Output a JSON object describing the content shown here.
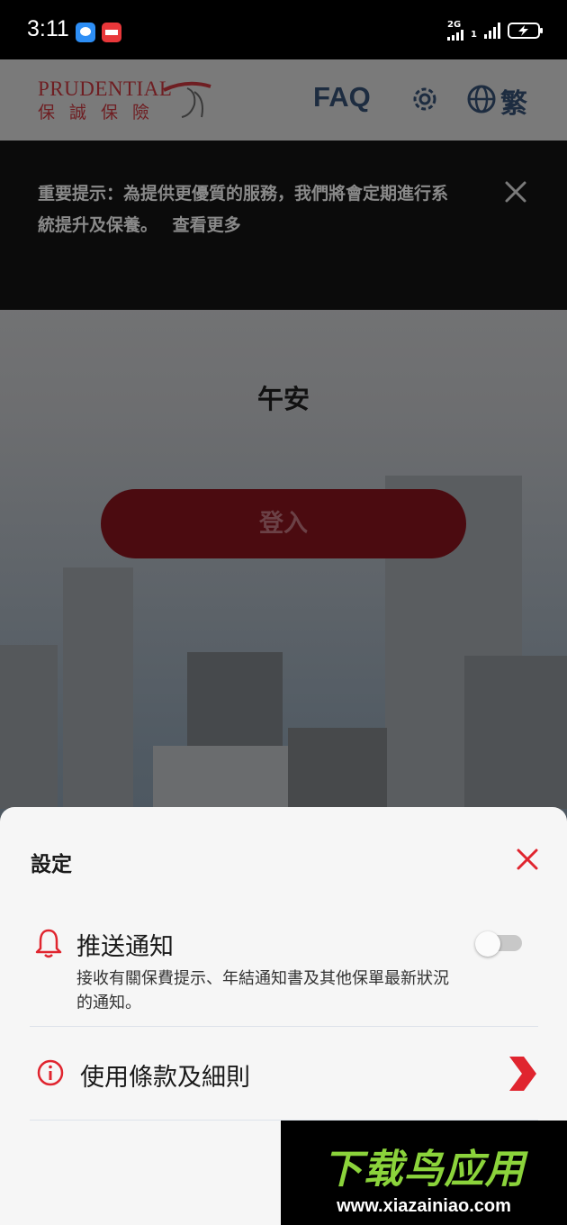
{
  "status_bar": {
    "time": "3:11",
    "network_label": "2G",
    "sim2_label": "1"
  },
  "header": {
    "logo_en": "PRUDENTIAL",
    "logo_zh": "保誠保險",
    "faq_label": "FAQ",
    "language_label": "繁"
  },
  "notice": {
    "text": "重要提示：為提供更優質的服務，我們將會定期進行系統提升及保養。",
    "link_label": "查看更多"
  },
  "main": {
    "greeting": "午安",
    "login_label": "登入"
  },
  "settings_sheet": {
    "title": "設定",
    "push": {
      "title": "推送通知",
      "description": "接收有關保費提示、年結通知書及其他保單最新狀況的通知。",
      "enabled": false
    },
    "terms_label": "使用條款及細則"
  },
  "watermark": {
    "title": "下载鸟应用",
    "url": "www.xiazainiao.com"
  },
  "colors": {
    "brand_red": "#e0252f",
    "sheet_bg": "#f6f6f6",
    "watermark_green": "#8bd33b"
  },
  "icons": [
    "message-app-icon",
    "toutiao-app-icon",
    "signal-icon",
    "battery-charging-icon",
    "gear-icon",
    "globe-icon",
    "close-icon",
    "bell-icon",
    "info-icon",
    "chevron-right-icon"
  ]
}
